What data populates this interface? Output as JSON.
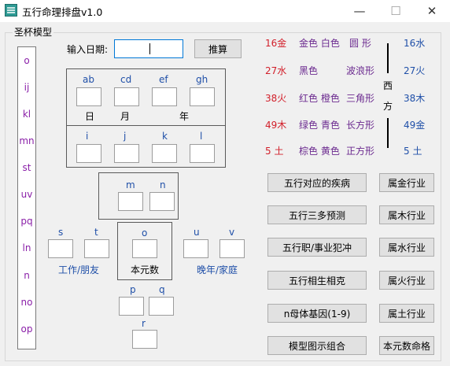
{
  "window": {
    "title": "五行命理排盘v1.0",
    "minimize": "—",
    "maximize": "☐",
    "close": "✕"
  },
  "group": {
    "title": "圣杯模型"
  },
  "left_list": [
    "o",
    "ij",
    "kl",
    "mn",
    "st",
    "uv",
    "pq",
    "ln",
    "n",
    "no",
    "op"
  ],
  "date": {
    "label": "输入日期:",
    "value": "",
    "button": "推算"
  },
  "grid": {
    "top_labels": [
      "ab",
      "cd",
      "ef",
      "gh"
    ],
    "day": "日",
    "month": "月",
    "year": "年",
    "mid_labels": [
      "i",
      "j",
      "k",
      "l"
    ],
    "m": "m",
    "n": "n",
    "o": "o",
    "s": "s",
    "t": "t",
    "u": "u",
    "v": "v",
    "p": "p",
    "q": "q",
    "r": "r",
    "work_friends": "工作/朋友",
    "self": "本元数",
    "late_family": "晚年/家庭"
  },
  "legend": {
    "rows": [
      {
        "num": "16金",
        "colors": "金色 白色",
        "shape": "圆 形",
        "right": "16水"
      },
      {
        "num": "27水",
        "colors": "黑色",
        "shape": "波浪形",
        "right": "27火"
      },
      {
        "num": "38火",
        "colors": "红色 橙色",
        "shape": "三角形",
        "right": "38木"
      },
      {
        "num": "49木",
        "colors": "绿色 青色",
        "shape": "长方形",
        "right": "49金"
      },
      {
        "num": "5 土",
        "colors": "棕色 黄色",
        "shape": "正方形",
        "right": "5 土"
      }
    ],
    "west": "西",
    "direction": "方"
  },
  "buttons": {
    "disease": "五行对应的疾病",
    "industry_gold": "属金行业",
    "three_many": "五行三多预测",
    "industry_wood": "属木行业",
    "career_clash": "五行职/事业犯冲",
    "industry_water": "属水行业",
    "mutual": "五行相生相克",
    "industry_fire": "属火行业",
    "mother_gene": "n母体基因(1-9)",
    "industry_earth": "属土行业",
    "combo": "模型图示组合",
    "self_char": "本元数命格"
  },
  "colors": {
    "red": "#d21f2a",
    "blue": "#1f4fa8",
    "purple": "#6b2a8f",
    "list": "#8a1fa8"
  }
}
